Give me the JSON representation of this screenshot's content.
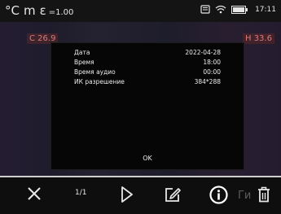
{
  "status": {
    "unit_c": "°C",
    "unit_m": "m",
    "emissivity_symbol": "ε",
    "emissivity_value": "=1.00",
    "time": "17:11"
  },
  "thermal": {
    "min_label": "C 26.9",
    "max_label": "H 33.6"
  },
  "info_dialog": {
    "rows": [
      {
        "label": "Дата",
        "value": "2022-04-28"
      },
      {
        "label": "Время",
        "value": "18:00"
      },
      {
        "label": "Время аудио",
        "value": "00:00"
      },
      {
        "label": "ИК разрешение",
        "value": "384*288"
      }
    ],
    "ok_label": "OK"
  },
  "toolbar": {
    "page": "1/1",
    "ghost_text": "Ги"
  },
  "icons": {
    "sd": "sd-card-icon",
    "wifi": "wifi-icon",
    "battery": "battery-icon",
    "close": "close-icon",
    "play": "play-icon",
    "edit": "edit-icon",
    "info": "info-icon",
    "delete": "delete-icon"
  }
}
